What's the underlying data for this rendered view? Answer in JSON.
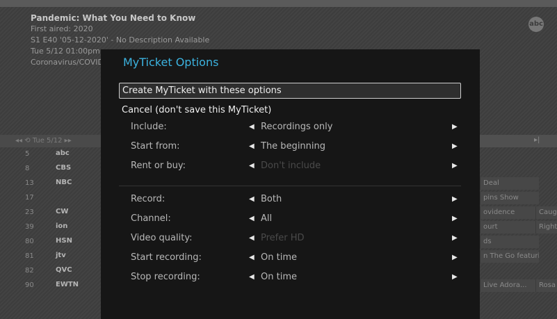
{
  "header": {
    "title": "Pandemic: What You Need to Know",
    "first_aired": "First aired: 2020",
    "episode": "S1 E40 '05-12-2020' - No Description Available",
    "airtime": "Tue 5/12 01:00pm",
    "tags": "Coronavirus/COVID",
    "network_logo": "abc"
  },
  "guide": {
    "date": "◂◂ ⟲ Tue 5/12 ▸▸",
    "right_header": "▸|",
    "rows": [
      {
        "num": "5",
        "logo": "abc",
        "cells": []
      },
      {
        "num": "8",
        "logo": "CBS",
        "cells": []
      },
      {
        "num": "13",
        "logo": "NBC",
        "cells": [
          {
            "t": "Deal"
          }
        ]
      },
      {
        "num": "17",
        "logo": "",
        "cells": [
          {
            "t": "pins Show"
          }
        ]
      },
      {
        "num": "23",
        "logo": "CW",
        "cells": [
          {
            "t": "ovidence"
          },
          {
            "t": "Caug"
          }
        ]
      },
      {
        "num": "39",
        "logo": "ion",
        "cells": [
          {
            "t": "ourt"
          },
          {
            "t": "Right"
          }
        ]
      },
      {
        "num": "80",
        "logo": "HSN",
        "cells": [
          {
            "t": "ds"
          }
        ]
      },
      {
        "num": "81",
        "logo": "jtv",
        "cells": [
          {
            "t": "n The Go featuring"
          }
        ]
      },
      {
        "num": "82",
        "logo": "QVC",
        "cells": []
      },
      {
        "num": "90",
        "logo": "EWTN",
        "cells": [
          {
            "t": "Live Adora..."
          },
          {
            "t": "Rosa"
          }
        ]
      }
    ]
  },
  "dialog": {
    "title": "MyTicket Options",
    "create_label": "Create MyTicket with these options",
    "cancel_label": "Cancel (don't save this MyTicket)",
    "options": [
      {
        "label": "Include:",
        "value": "Recordings only",
        "dim": false
      },
      {
        "label": "Start from:",
        "value": "The beginning",
        "dim": false
      },
      {
        "label": "Rent or buy:",
        "value": "Don't include",
        "dim": true
      },
      {
        "label": "Record:",
        "value": "Both",
        "dim": false
      },
      {
        "label": "Channel:",
        "value": "All",
        "dim": false
      },
      {
        "label": "Video quality:",
        "value": "Prefer HD",
        "dim": true
      },
      {
        "label": "Start recording:",
        "value": "On time",
        "dim": false
      },
      {
        "label": "Stop recording:",
        "value": "On time",
        "dim": false
      }
    ]
  },
  "colors": {
    "accent": "#3cb3e0",
    "dialog_bg": "#161616"
  }
}
